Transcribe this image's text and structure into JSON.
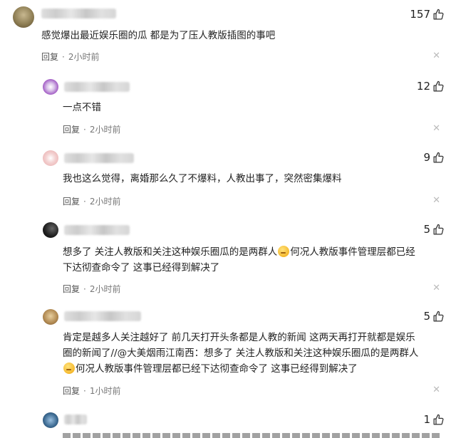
{
  "comments": [
    {
      "text": "感觉爆出最近娱乐圈的瓜 都是为了压人教版插图的事吧",
      "likes": "157",
      "reply": "回复",
      "dot": "·",
      "time": "2小时前"
    },
    {
      "text": "一点不错",
      "likes": "12",
      "reply": "回复",
      "dot": "·",
      "time": "2小时前"
    },
    {
      "text": "我也这么觉得，离婚那么久了不爆料，人教出事了，突然密集爆料",
      "likes": "9",
      "reply": "回复",
      "dot": "·",
      "time": "2小时前"
    },
    {
      "text_a": "想多了 关注人教版和关注这种娱乐圈瓜的是两群人",
      "text_b": "何况人教版事件管理层都已经",
      "text_c": "下达彻查命令了 这事已经得到解决了",
      "likes": "5",
      "reply": "回复",
      "dot": "·",
      "time": "2小时前"
    },
    {
      "line1": "肯定是越多人关注越好了 前几天打开头条都是人教的新闻 这两天再打开就都是娱乐",
      "line2": "圈的新闻了//@大美烟雨江南西：想多了 关注人教版和关注这种娱乐圈瓜的是两群人",
      "line3": "何况人教版事件管理层都已经下达彻查命令了 这事已经得到解决了",
      "likes": "5",
      "reply": "回复",
      "dot": "·",
      "time": "1小时前"
    },
    {
      "likes": "1"
    }
  ],
  "icons": {
    "like": "thumbs-up-icon",
    "close": "close-icon",
    "emoji": "sad-face-emoji-icon"
  },
  "colors": {
    "text": "#222222",
    "meta": "#777777",
    "close": "#bbbbbb"
  }
}
